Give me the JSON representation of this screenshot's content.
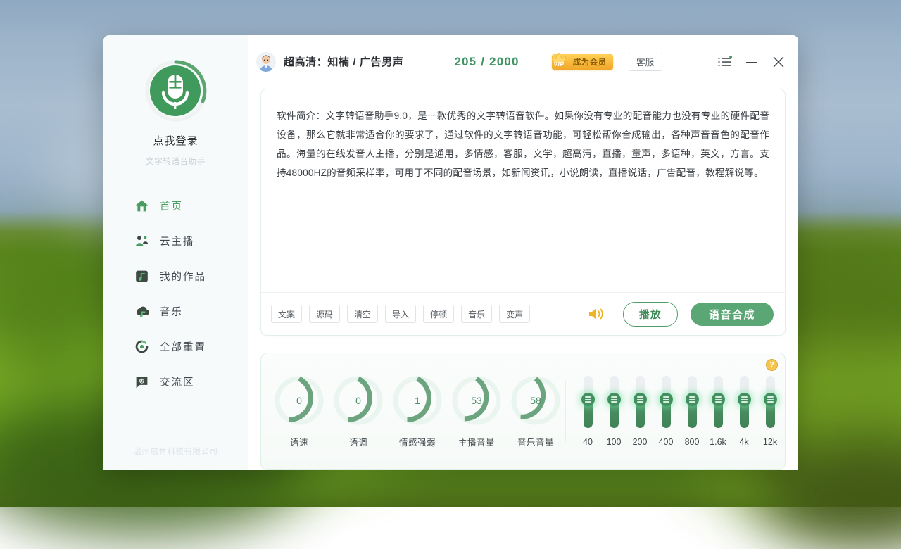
{
  "window": {
    "title": "文字转语音助手"
  },
  "sidebar": {
    "login_label": "点我登录",
    "app_subtitle": "文字转语音助手",
    "footer": "温州启肯科技有限公司",
    "items": [
      {
        "label": "首页",
        "icon": "home-icon",
        "active": true
      },
      {
        "label": "云主播",
        "icon": "cloud-anchor-icon",
        "active": false
      },
      {
        "label": "我的作品",
        "icon": "my-works-icon",
        "active": false
      },
      {
        "label": "音乐",
        "icon": "music-icon",
        "active": false
      },
      {
        "label": "全部重置",
        "icon": "reset-icon",
        "active": false
      },
      {
        "label": "交流区",
        "icon": "chat-icon",
        "active": false
      }
    ]
  },
  "titlebar": {
    "voice_title": "超高清：知楠 / 广告男声",
    "counter": "205 / 2000",
    "vip_label": "成为会员",
    "vip_tag": "VIP",
    "support_label": "客服",
    "menu_icon": "menu-icon",
    "minimize_icon": "minimize-icon",
    "close_icon": "close-icon"
  },
  "editor": {
    "text": "软件简介：文字转语音助手9.0，是一款优秀的文字转语音软件。如果你没有专业的配音能力也没有专业的硬件配音设备，那么它就非常适合你的要求了，通过软件的文字转语音功能，可轻松帮你合成输出，各种声音音色的配音作品。海量的在线发音人主播，分别是通用，多情感，客服，文学，超高清，直播，童声，多语种，英文，方言。支持48000HZ的音频采样率，可用于不同的配音场景，如新闻资讯，小说朗读，直播说话，广告配音，教程解说等。",
    "toolbar_buttons": [
      {
        "label": "文案"
      },
      {
        "label": "源码"
      },
      {
        "label": "清空"
      },
      {
        "label": "导入"
      },
      {
        "label": "停顿"
      },
      {
        "label": "音乐"
      },
      {
        "label": "变声"
      }
    ],
    "speaker_icon": "speaker-icon",
    "play_label": "播放",
    "synth_label": "语音合成"
  },
  "controls": {
    "help_label": "?",
    "gauges": [
      {
        "label": "语速",
        "value": "0",
        "pct": 50
      },
      {
        "label": "语调",
        "value": "0",
        "pct": 50
      },
      {
        "label": "情感强弱",
        "value": "1",
        "pct": 50
      },
      {
        "label": "主播音量",
        "value": "53",
        "pct": 53
      },
      {
        "label": "音乐音量",
        "value": "58",
        "pct": 58
      }
    ],
    "equalizer": [
      {
        "label": "40",
        "pct": 54
      },
      {
        "label": "100",
        "pct": 54
      },
      {
        "label": "200",
        "pct": 54
      },
      {
        "label": "400",
        "pct": 54
      },
      {
        "label": "800",
        "pct": 54
      },
      {
        "label": "1.6k",
        "pct": 54
      },
      {
        "label": "4k",
        "pct": 54
      },
      {
        "label": "12k",
        "pct": 54
      }
    ]
  },
  "colors": {
    "brand_green": "#4f9e69",
    "accent_green": "#5aa674",
    "counter_green": "#3f9363",
    "vip_gold": "#f8b93a"
  }
}
